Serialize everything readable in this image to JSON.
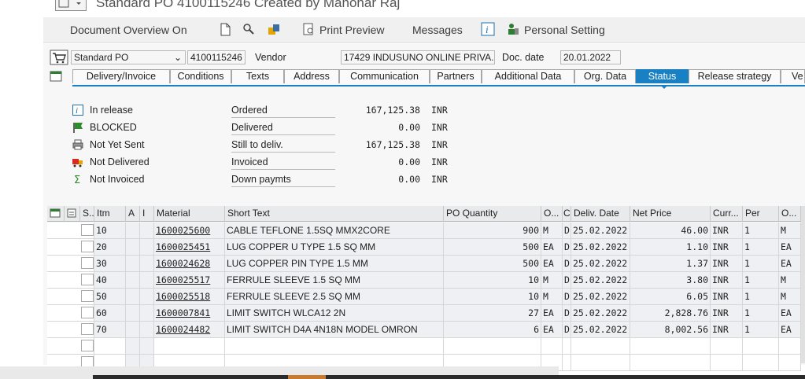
{
  "window": {
    "title": "Standard PO 4100115246 Created by Manohar Raj"
  },
  "toolbar": {
    "document_overview": "Document Overview On",
    "print_preview": "Print Preview",
    "messages": "Messages",
    "personal_setting": "Personal Setting"
  },
  "header": {
    "doc_type": "Standard PO",
    "po_number": "4100115246",
    "vendor_label": "Vendor",
    "vendor_value": "17429 INDUSUNO ONLINE PRIVA...",
    "doc_date_label": "Doc. date",
    "doc_date_value": "20.01.2022"
  },
  "tabs": [
    "Delivery/Invoice",
    "Conditions",
    "Texts",
    "Address",
    "Communication",
    "Partners",
    "Additional Data",
    "Org. Data",
    "Status",
    "Release strategy",
    "Ve"
  ],
  "active_tab": "Status",
  "status": [
    {
      "icon": "info-icon",
      "text": "In release",
      "label": "Ordered",
      "value": "167,125.38",
      "currency": "INR"
    },
    {
      "icon": "flag-icon",
      "text": "BLOCKED",
      "label": "Delivered",
      "value": "0.00",
      "currency": "INR"
    },
    {
      "icon": "printer-icon",
      "text": "Not Yet Sent",
      "label": "Still to deliv.",
      "value": "167,125.38",
      "currency": "INR"
    },
    {
      "icon": "truck-icon",
      "text": "Not Delivered",
      "label": "Invoiced",
      "value": "0.00",
      "currency": "INR"
    },
    {
      "icon": "sigma-icon",
      "text": "Not Invoiced",
      "label": "Down paymts",
      "value": "0.00",
      "currency": "INR"
    }
  ],
  "grid": {
    "headers": {
      "s": "S..",
      "itm": "Itm",
      "a": "A",
      "i": "I",
      "material": "Material",
      "short_text": "Short Text",
      "po_qty": "PO Quantity",
      "o": "O...",
      "c": "C",
      "deliv_date": "Deliv. Date",
      "net_price": "Net Price",
      "curr": "Curr...",
      "per": "Per",
      "o2": "O..."
    },
    "rows": [
      {
        "itm": "10",
        "material": "1600025600",
        "short_text": "CABLE TEFLONE 1.5SQ MMX2CORE",
        "qty": "900",
        "unit": "M",
        "c": "D",
        "date": "25.02.2022",
        "price": "46.00",
        "curr": "INR",
        "per": "1",
        "o2": "M"
      },
      {
        "itm": "20",
        "material": "1600025451",
        "short_text": "LUG COPPER U TYPE 1.5 SQ MM",
        "qty": "500",
        "unit": "EA",
        "c": "D",
        "date": "25.02.2022",
        "price": "1.10",
        "curr": "INR",
        "per": "1",
        "o2": "EA"
      },
      {
        "itm": "30",
        "material": "1600024628",
        "short_text": "LUG COPPER PIN TYPE 1.5 MM",
        "qty": "500",
        "unit": "EA",
        "c": "D",
        "date": "25.02.2022",
        "price": "1.37",
        "curr": "INR",
        "per": "1",
        "o2": "EA"
      },
      {
        "itm": "40",
        "material": "1600025517",
        "short_text": "FERRULE SLEEVE 1.5 SQ MM",
        "qty": "10",
        "unit": "M",
        "c": "D",
        "date": "25.02.2022",
        "price": "3.80",
        "curr": "INR",
        "per": "1",
        "o2": "M"
      },
      {
        "itm": "50",
        "material": "1600025518",
        "short_text": "FERRULE SLEEVE 2.5 SQ MM",
        "qty": "10",
        "unit": "M",
        "c": "D",
        "date": "25.02.2022",
        "price": "6.05",
        "curr": "INR",
        "per": "1",
        "o2": "M"
      },
      {
        "itm": "60",
        "material": "1600007841",
        "short_text": "LIMIT SWITCH WLCA12 2N",
        "qty": "27",
        "unit": "EA",
        "c": "D",
        "date": "25.02.2022",
        "price": "2,828.76",
        "curr": "INR",
        "per": "1",
        "o2": "EA"
      },
      {
        "itm": "70",
        "material": "1600024482",
        "short_text": "LIMIT SWITCH D4A 4N18N MODEL OMRON",
        "qty": "6",
        "unit": "EA",
        "c": "D",
        "date": "25.02.2022",
        "price": "8,002.56",
        "curr": "INR",
        "per": "1",
        "o2": "EA"
      }
    ]
  },
  "colors": {
    "accent": "#1a80c4",
    "toolbar_bg": "#f0f0f0",
    "grid_row": "#eef0f3"
  }
}
